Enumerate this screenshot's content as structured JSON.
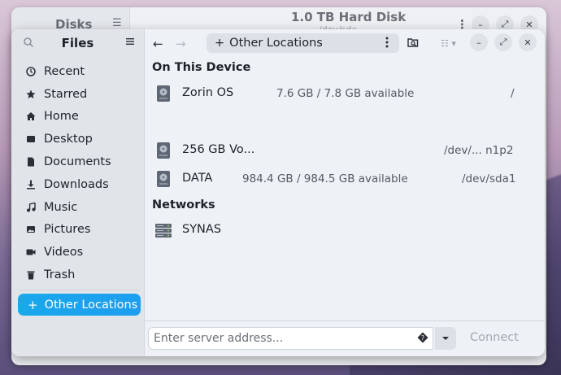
{
  "disks": {
    "title": "Disks",
    "main_title": "1.0 TB Hard Disk",
    "subtitle": "/dev/sda"
  },
  "sidebar": {
    "title": "Files",
    "items": [
      {
        "label": "Recent",
        "icon": "clock-icon"
      },
      {
        "label": "Starred",
        "icon": "star-icon"
      },
      {
        "label": "Home",
        "icon": "home-icon"
      },
      {
        "label": "Desktop",
        "icon": "desktop-icon"
      },
      {
        "label": "Documents",
        "icon": "document-icon"
      },
      {
        "label": "Downloads",
        "icon": "download-icon"
      },
      {
        "label": "Music",
        "icon": "music-icon"
      },
      {
        "label": "Pictures",
        "icon": "picture-icon"
      },
      {
        "label": "Videos",
        "icon": "video-icon"
      },
      {
        "label": "Trash",
        "icon": "trash-icon"
      }
    ],
    "other_locations": "Other Locations"
  },
  "header": {
    "location": "Other Locations"
  },
  "content": {
    "on_this_device": "On This Device",
    "devices": [
      {
        "name": "Zorin OS",
        "space": "7.6 GB / 7.8 GB available",
        "path": "/"
      },
      {
        "name": "256 GB Vo...",
        "space": "",
        "path": "/dev/... n1p2"
      },
      {
        "name": "DATA",
        "space": "984.4 GB / 984.5 GB available",
        "path": "/dev/sda1"
      }
    ],
    "networks": "Networks",
    "network_items": [
      {
        "name": "SYNAS"
      }
    ]
  },
  "bottom": {
    "placeholder": "Enter server address...",
    "connect": "Connect"
  },
  "colors": {
    "accent": "#1aa8ea",
    "sidebar_bg": "#e1e5ea",
    "window_bg": "#eef1f5"
  }
}
